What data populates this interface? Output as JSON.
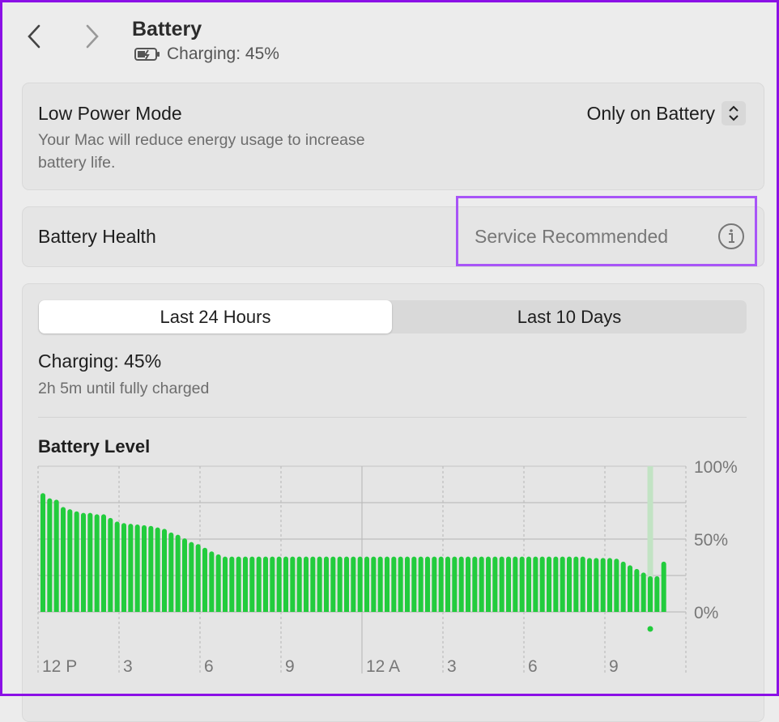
{
  "header": {
    "title": "Battery",
    "status": "Charging: 45%",
    "back_icon": "chevron-left-icon",
    "forward_icon": "chevron-right-icon",
    "battery_icon": "battery-charging-icon"
  },
  "low_power": {
    "label": "Low Power Mode",
    "description_line1": "Your Mac will reduce energy usage to increase",
    "description_line2": "battery life.",
    "value": "Only on Battery"
  },
  "battery_health": {
    "label": "Battery Health",
    "value": "Service Recommended"
  },
  "tabs": [
    {
      "label": "Last 24 Hours",
      "selected": true
    },
    {
      "label": "Last 10 Days",
      "selected": false
    }
  ],
  "status": {
    "title": "Charging: 45%",
    "detail": "2h 5m until fully charged"
  },
  "colors": {
    "bar": "#22cc3d",
    "highlight": "#a855f7",
    "frame": "#8b10e6"
  },
  "chart_data": {
    "type": "bar",
    "title": "Battery Level",
    "interval": "15 min",
    "ylim": [
      0,
      100
    ],
    "yticks": [
      "100%",
      "50%",
      "0%"
    ],
    "xticks": [
      "12 P",
      "3",
      "6",
      "9",
      "12 A",
      "3",
      "6",
      "9"
    ],
    "grid": true,
    "values": [
      81.5,
      78,
      77,
      72,
      70.5,
      69,
      68,
      68,
      67,
      67,
      64.5,
      62,
      61,
      60.5,
      60,
      59.5,
      59,
      58,
      57,
      54.5,
      53,
      50.5,
      48,
      46.5,
      44,
      41.5,
      39.5,
      38,
      38,
      38,
      38,
      38,
      38,
      38,
      38,
      38,
      38,
      38,
      38,
      38,
      38,
      38,
      38,
      38,
      38,
      38,
      38,
      38,
      38,
      38,
      38,
      38,
      38,
      38,
      38,
      38,
      38,
      38,
      38,
      38,
      38,
      38,
      38,
      38,
      38,
      38,
      38,
      38,
      38,
      38,
      38,
      38,
      38,
      38,
      38,
      38,
      38,
      38,
      38,
      38,
      38,
      37,
      37,
      37,
      37,
      36.5,
      34.5,
      32,
      29.5,
      27,
      24.5,
      24.5,
      34.5
    ],
    "charging_marker_index": 90
  }
}
